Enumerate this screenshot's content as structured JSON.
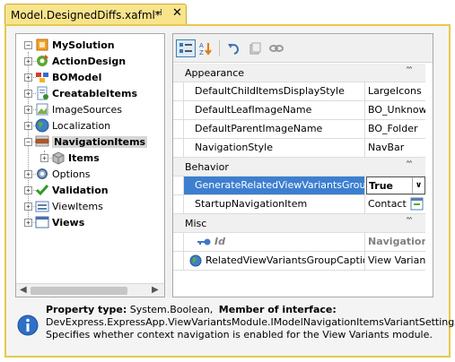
{
  "tab": {
    "title": "Model.DesignedDiffs.xafml*",
    "pin_glyph": "⊣",
    "close_glyph": "✕"
  },
  "tree": {
    "root": "MySolution",
    "items": [
      {
        "label": "ActionDesign",
        "bold": true,
        "expandable": true
      },
      {
        "label": "BOModel",
        "bold": true,
        "expandable": true
      },
      {
        "label": "CreatableItems",
        "bold": true,
        "expandable": true
      },
      {
        "label": "ImageSources",
        "bold": false,
        "expandable": true
      },
      {
        "label": "Localization",
        "bold": false,
        "expandable": true
      },
      {
        "label": "NavigationItems",
        "bold": true,
        "expandable": true,
        "selected": true
      },
      {
        "label": "Items",
        "bold": true,
        "expandable": true,
        "child": true
      },
      {
        "label": "Options",
        "bold": false,
        "expandable": true
      },
      {
        "label": "Validation",
        "bold": true,
        "expandable": true
      },
      {
        "label": "ViewItems",
        "bold": false,
        "expandable": true
      },
      {
        "label": "Views",
        "bold": true,
        "expandable": true
      }
    ],
    "scroll_left": "◀",
    "scroll_right": "▶"
  },
  "toolbar": {
    "icons": [
      "categorized-icon",
      "alphabetical-icon",
      "undo-icon",
      "copy-icon",
      "link-icon"
    ]
  },
  "grid": {
    "categories": [
      {
        "name": "Appearance",
        "rows": [
          {
            "name": "DefaultChildItemsDisplayStyle",
            "value": "LargeIcons"
          },
          {
            "name": "DefaultLeafImageName",
            "value": "BO_Unknown"
          },
          {
            "name": "DefaultParentImageName",
            "value": "BO_Folder"
          },
          {
            "name": "NavigationStyle",
            "value": "NavBar"
          }
        ]
      },
      {
        "name": "Behavior",
        "rows": [
          {
            "name": "GenerateRelatedViewVariantsGroup",
            "value": "True",
            "selected": true
          },
          {
            "name": "StartupNavigationItem",
            "value": "Contact"
          }
        ]
      },
      {
        "name": "Misc",
        "rows": [
          {
            "name": "Id",
            "value": "NavigationItems",
            "key": true
          },
          {
            "name": "RelatedViewVariantsGroupCaption",
            "value": "View Variants"
          }
        ]
      }
    ],
    "collapse_glyph": "˄˄",
    "dropdown_glyph": "∨"
  },
  "description": {
    "type_label": "Property type:",
    "type_value": "System.Boolean,",
    "iface_label": "Member of interface:",
    "iface_value": "DevExpress.ExpressApp.ViewVariantsModule.IModelNavigationItemsVariantSettings",
    "text": "Specifies whether context navigation is enabled for the View Variants module."
  },
  "colors": {
    "tab_active": "#f7e48c",
    "selection": "#3c7fd0",
    "frame": "#e7c94a"
  }
}
